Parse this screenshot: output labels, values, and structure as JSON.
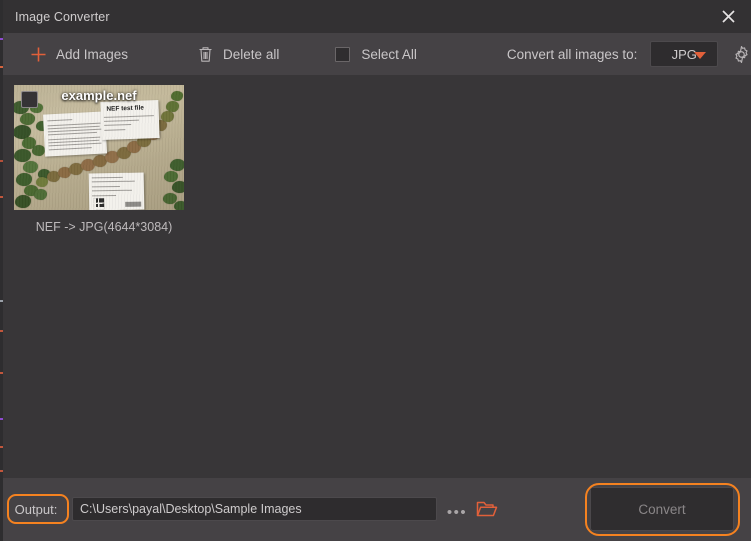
{
  "window": {
    "title": "Image Converter",
    "close_icon": "close-icon"
  },
  "toolbar": {
    "add_images_label": "Add Images",
    "add_images_icon": "plus-icon",
    "delete_all_label": "Delete all",
    "delete_all_icon": "trash-icon",
    "select_all_label": "Select All",
    "select_all_checked": false,
    "convert_to_label": "Convert all images to:",
    "format_value": "JPG",
    "format_options": [
      "JPG"
    ],
    "caret_icon": "chevron-down-icon",
    "settings_icon": "gear-icon"
  },
  "content": {
    "items": [
      {
        "filename": "example.nef",
        "conversion": "NEF -> JPG(4644*3084)",
        "selected": false,
        "thumbnail_alt": "photo of ivy vine on a beige wall with three printed paper sheets",
        "paper_heading": "NEF test file"
      }
    ]
  },
  "bottom": {
    "output_label": "Output:",
    "output_path": "C:\\Users\\payal\\Desktop\\Sample Images",
    "browse_dots_label": "•••",
    "folder_icon": "folder-open-icon",
    "convert_label": "Convert",
    "convert_enabled": false
  },
  "colors": {
    "accent": "#e2603a",
    "highlight": "#f58220",
    "titlebar_bg": "#333133",
    "toolbar_bg": "#454245",
    "content_bg": "#383638",
    "text": "#c9c6c8"
  }
}
